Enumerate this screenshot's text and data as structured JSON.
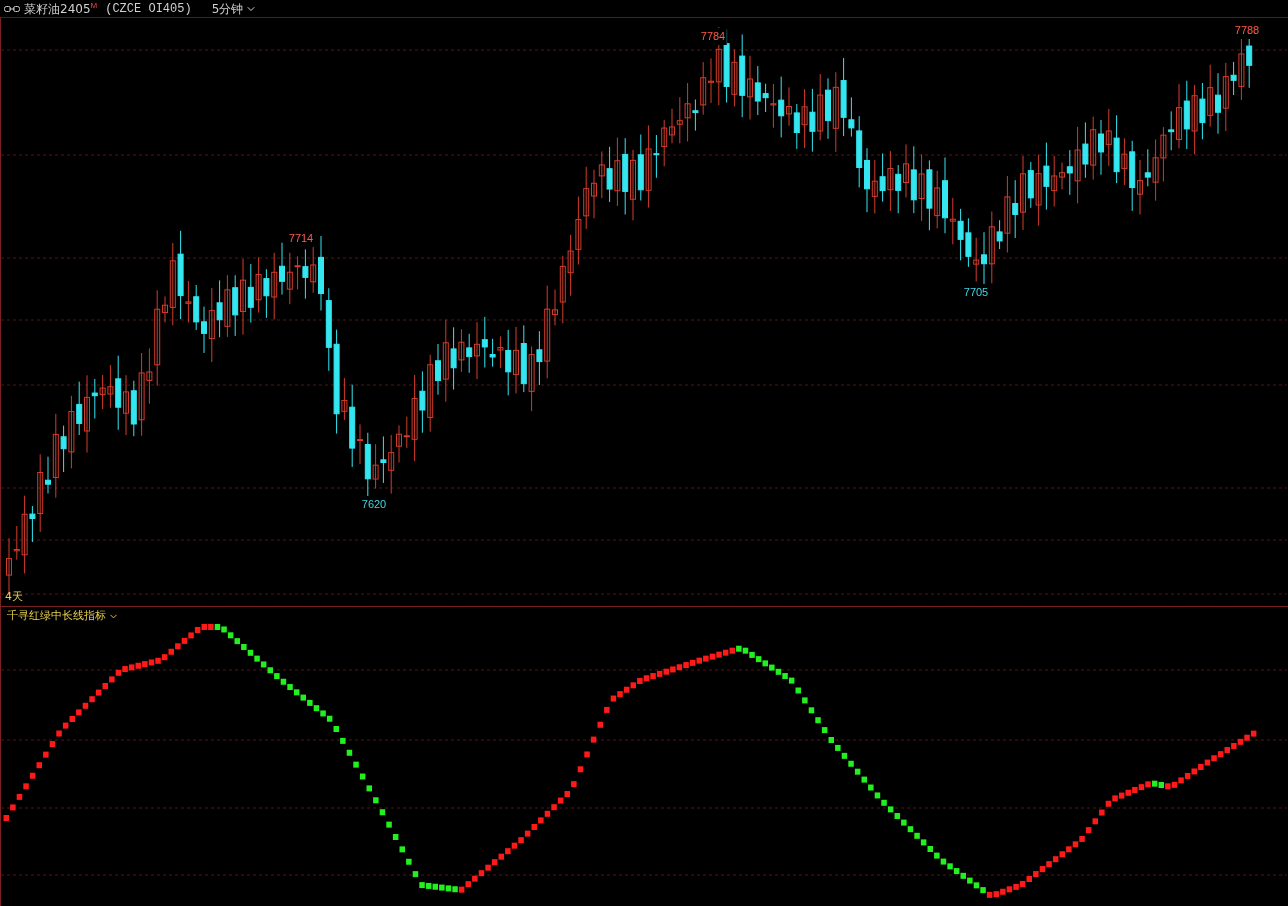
{
  "instrument": {
    "name": "菜籽油2405",
    "badge": "M",
    "code": "(CZCE OI405)",
    "period": "5分钟"
  },
  "price_chart": {
    "labels": [
      {
        "text": "7714",
        "kind": "high"
      },
      {
        "text": "7784",
        "kind": "high"
      },
      {
        "text": "7788",
        "kind": "high"
      },
      {
        "text": "7620",
        "kind": "low"
      },
      {
        "text": "7705",
        "kind": "low"
      }
    ],
    "range_label": "4天"
  },
  "indicator": {
    "title": "千寻红绿中长线指标"
  }
}
